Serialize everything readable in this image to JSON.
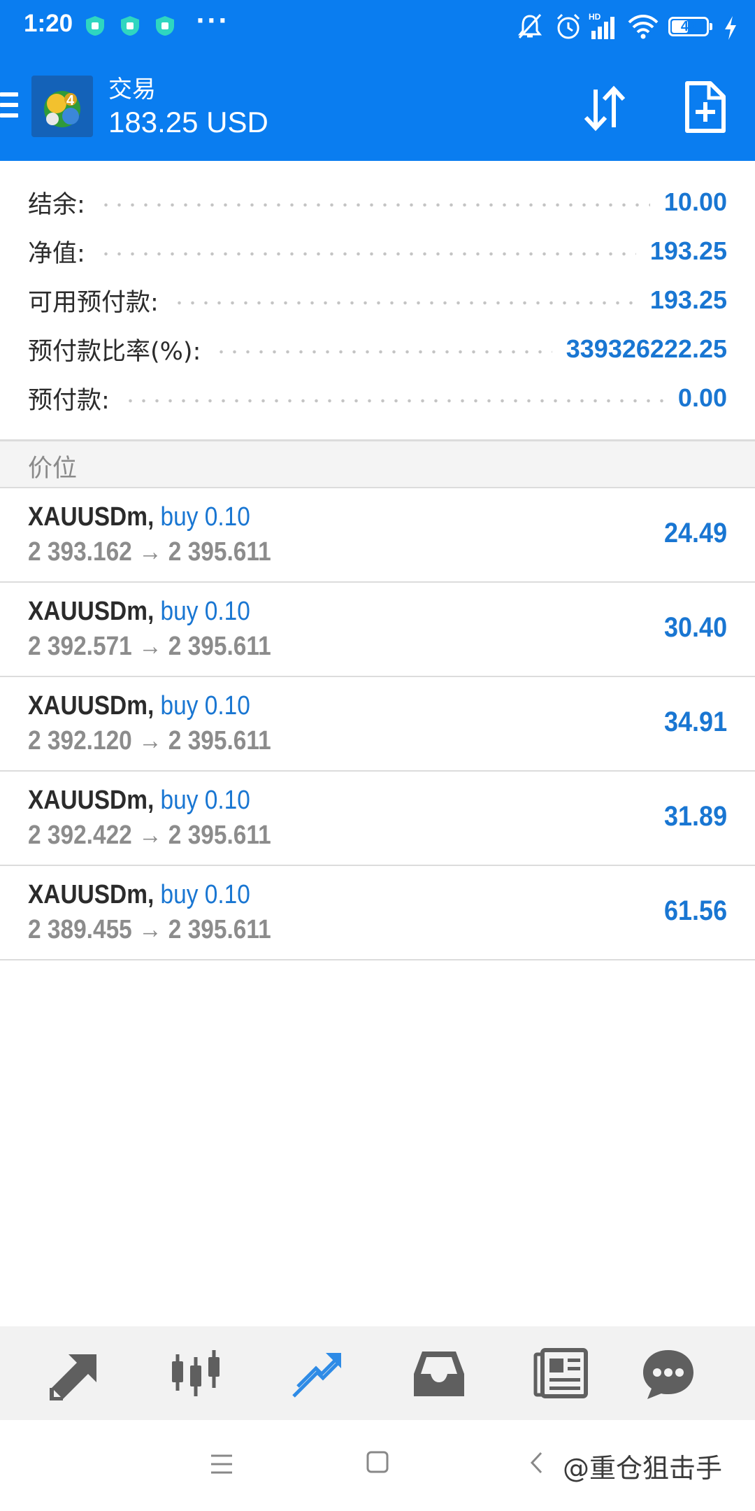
{
  "status_bar": {
    "time": "1:20",
    "left_icons": [
      "shield-icon",
      "shield-icon",
      "shield-icon",
      "more-dots-icon"
    ],
    "dots": "···",
    "right_icons": [
      "mute-icon",
      "alarm-icon",
      "hd-signal-icon",
      "wifi-icon",
      "battery-icon",
      "charging-icon"
    ],
    "battery_level": "43"
  },
  "app_bar": {
    "title": "交易",
    "subtitle": "183.25 USD",
    "colors": {
      "bar": "#0a7df0",
      "accent": "#1976d2"
    }
  },
  "summary": [
    {
      "label": "结余:",
      "value": "10.00"
    },
    {
      "label": "净值:",
      "value": "193.25"
    },
    {
      "label": "可用预付款:",
      "value": "193.25"
    },
    {
      "label": "预付款比率(%):",
      "value": "339326222.25"
    },
    {
      "label": "预付款:",
      "value": "0.00"
    }
  ],
  "section_header": "价位",
  "positions": [
    {
      "symbol": "XAUUSDm,",
      "side": "buy 0.10",
      "open": "2 393.162",
      "arrow": "→",
      "current": "2 395.611",
      "profit": "24.49"
    },
    {
      "symbol": "XAUUSDm,",
      "side": "buy 0.10",
      "open": "2 392.571",
      "arrow": "→",
      "current": "2 395.611",
      "profit": "30.40"
    },
    {
      "symbol": "XAUUSDm,",
      "side": "buy 0.10",
      "open": "2 392.120",
      "arrow": "→",
      "current": "2 395.611",
      "profit": "34.91"
    },
    {
      "symbol": "XAUUSDm,",
      "side": "buy 0.10",
      "open": "2 392.422",
      "arrow": "→",
      "current": "2 395.611",
      "profit": "31.89"
    },
    {
      "symbol": "XAUUSDm,",
      "side": "buy 0.10",
      "open": "2 389.455",
      "arrow": "→",
      "current": "2 395.611",
      "profit": "61.56"
    }
  ],
  "bottom_nav": [
    {
      "icon": "quotes-arrows-icon",
      "active": false
    },
    {
      "icon": "candlestick-chart-icon",
      "active": false
    },
    {
      "icon": "trade-trend-icon",
      "active": true
    },
    {
      "icon": "history-inbox-icon",
      "active": false
    },
    {
      "icon": "news-icon",
      "active": false
    },
    {
      "icon": "chat-bubble-icon",
      "active": false
    }
  ],
  "system_nav": {
    "icons": [
      "recent-apps-icon",
      "home-icon",
      "back-icon"
    ],
    "watermark": "@重仓狙击手"
  }
}
